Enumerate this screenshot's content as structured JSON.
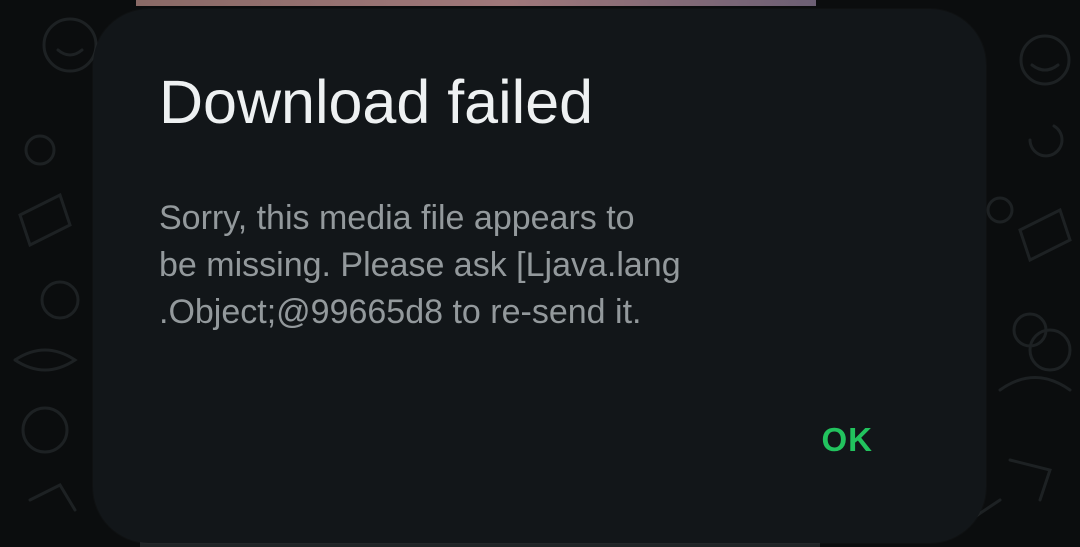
{
  "dialog": {
    "title": "Download failed",
    "message": "Sorry, this media file appears to\nbe missing. Please ask [Ljava.lang\n.Object;@99665d8 to re-send it.",
    "ok_label": "OK"
  },
  "colors": {
    "dialog_background": "#121619",
    "title_text": "#eef1f2",
    "message_text": "#93999c",
    "accent": "#22c35e",
    "wallpaper": "#0b0d0e"
  }
}
